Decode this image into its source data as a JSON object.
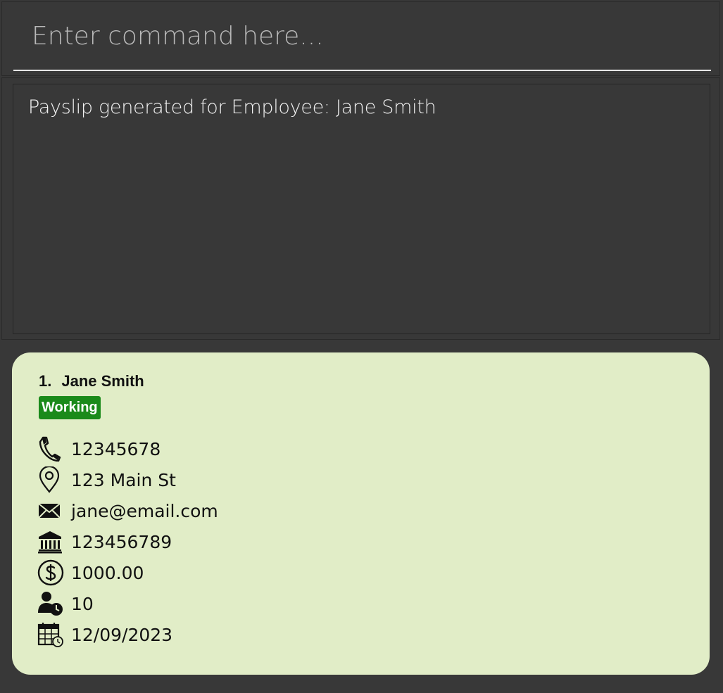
{
  "command_box": {
    "placeholder": "Enter command here..."
  },
  "result_display": {
    "message": "Payslip generated for Employee: Jane Smith"
  },
  "employee_list": {
    "employees": [
      {
        "index": "1.",
        "name": "Jane Smith",
        "status": "Working",
        "status_color": "#1a8a1a",
        "fields": [
          {
            "icon": "phone-icon",
            "value": "12345678"
          },
          {
            "icon": "location-pin-icon",
            "value": "123 Main St"
          },
          {
            "icon": "envelope-icon",
            "value": "jane@email.com"
          },
          {
            "icon": "bank-icon",
            "value": "123456789"
          },
          {
            "icon": "dollar-circle-icon",
            "value": "1000.00"
          },
          {
            "icon": "person-clock-icon",
            "value": "10"
          },
          {
            "icon": "calendar-clock-icon",
            "value": "12/09/2023"
          }
        ]
      }
    ]
  },
  "colors": {
    "background": "#383838",
    "card_background": "#e1edc7",
    "text_light": "#f2f2f2"
  }
}
